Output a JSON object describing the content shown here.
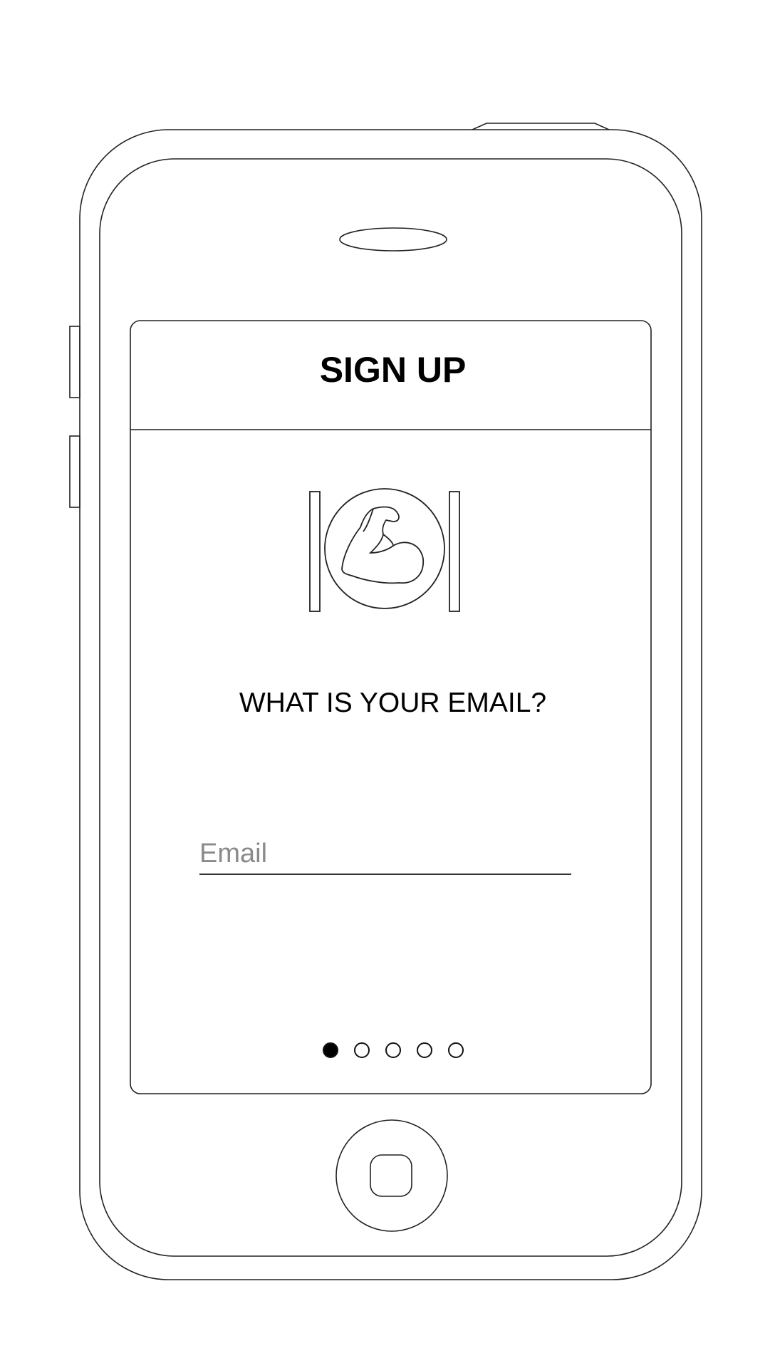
{
  "header": {
    "title": "SIGN UP"
  },
  "logo": {
    "icon": "flexed-bicep-icon"
  },
  "form": {
    "question": "WHAT IS YOUR EMAIL?",
    "email_placeholder": "Email",
    "email_value": ""
  },
  "pager": {
    "total": 5,
    "current": 1
  },
  "colors": {
    "outline": "#222222",
    "text": "#000000",
    "placeholder": "#8a8a8a",
    "background": "#ffffff"
  }
}
